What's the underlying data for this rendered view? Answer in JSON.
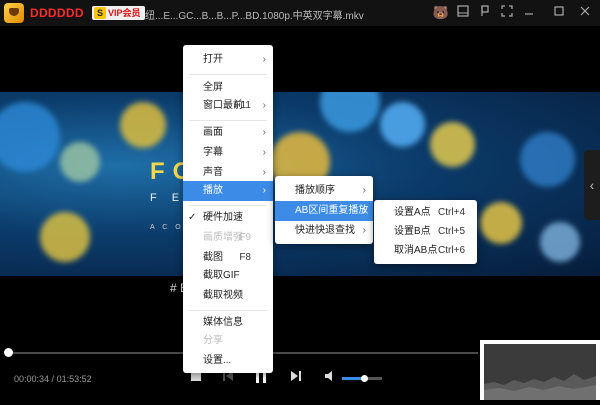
{
  "titlebar": {
    "brand": "DDDDDD",
    "vip": {
      "icon": "S",
      "label": "VIP会员"
    },
    "title": "纽...E...GC...B...B...P...BD.1080p.中英双字幕.mkv",
    "icons": [
      "bear-icon",
      "minimize-to-tray-icon",
      "pin-icon",
      "fullscreen-icon",
      "minimize-icon",
      "maximize-icon",
      "close-icon"
    ]
  },
  "video": {
    "title_text": "FO   S",
    "sub_text": "F E",
    "sub2_text": "A C O",
    "caption": "# E"
  },
  "menu_main": {
    "items": [
      {
        "label": "打开",
        "submenu": true
      },
      {
        "label": "全屏"
      },
      {
        "label": "窗口最前",
        "shortcut": "F11",
        "submenu": true
      },
      {
        "label": "画面",
        "submenu": true
      },
      {
        "label": "字幕",
        "submenu": true
      },
      {
        "label": "声音",
        "submenu": true
      },
      {
        "label": "播放",
        "submenu": true,
        "active": true
      },
      {
        "label": "硬件加速",
        "checked": true
      },
      {
        "label": "画质增强",
        "shortcut": "F9",
        "disabled": true
      },
      {
        "label": "截图",
        "shortcut": "F8"
      },
      {
        "label": "截取GIF"
      },
      {
        "label": "截取视频"
      },
      {
        "label": "媒体信息"
      },
      {
        "label": "分享",
        "disabled": true
      },
      {
        "label": "设置..."
      }
    ]
  },
  "menu_play": {
    "items": [
      {
        "label": "播放顺序",
        "submenu": true
      },
      {
        "label": "AB区间重复播放",
        "submenu": true,
        "active": true
      },
      {
        "label": "快进快退查找",
        "submenu": true
      }
    ]
  },
  "menu_ab": {
    "items": [
      {
        "label": "设置A点",
        "shortcut": "Ctrl+4"
      },
      {
        "label": "设置B点",
        "shortcut": "Ctrl+5"
      },
      {
        "label": "取消AB点",
        "shortcut": "Ctrl+6"
      }
    ]
  },
  "controls": {
    "current_time": "00:00:34",
    "total_time": "01:53:52",
    "time_sep": " / ",
    "progress_fraction": 0.005,
    "volume_fraction": 0.55
  },
  "colors": {
    "accent": "#3c8ce7",
    "brand": "#ff2d2d",
    "title_gold": "#f4d84a"
  }
}
